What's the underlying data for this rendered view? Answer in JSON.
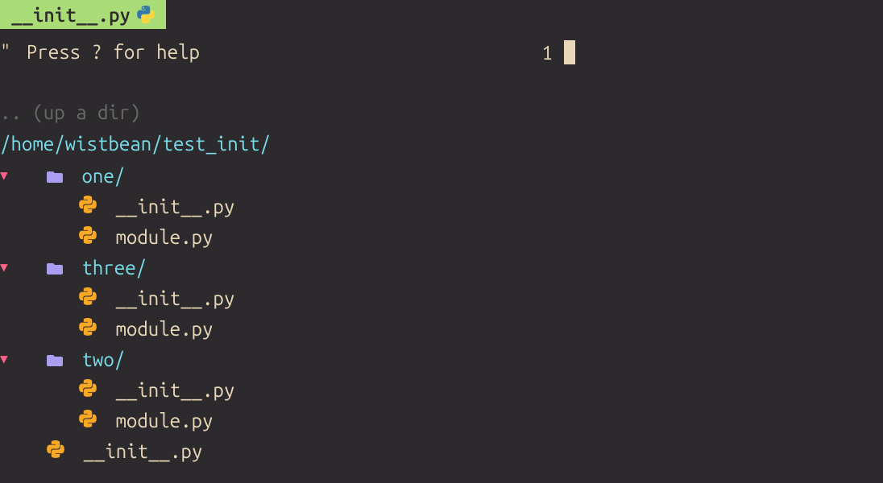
{
  "tab": {
    "filename": "__init__.py",
    "icon": "python-icon"
  },
  "tree": {
    "help_quote": "\"",
    "help_text": " Press ? for help",
    "up_dir": ".. (up a dir)",
    "root_path": "/home/wistbean/test_init/",
    "folders": [
      {
        "name": "one/",
        "files": [
          "__init__.py",
          "module.py"
        ]
      },
      {
        "name": "three/",
        "files": [
          "__init__.py",
          "module.py"
        ]
      },
      {
        "name": "two/",
        "files": [
          "__init__.py",
          "module.py"
        ]
      }
    ],
    "root_files": [
      "__init__.py"
    ]
  },
  "editor": {
    "line_number": "1"
  }
}
